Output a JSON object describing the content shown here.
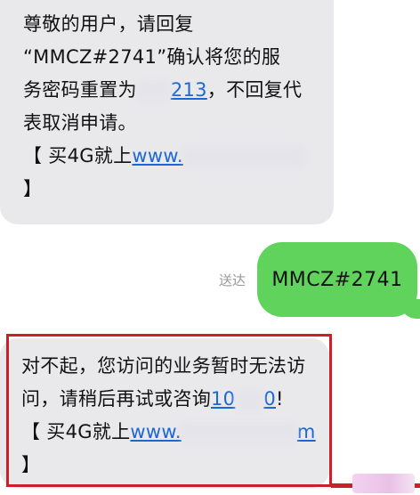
{
  "message1": {
    "line1": "尊敬的用户，请回复",
    "line2": "“MMCZ#2741”确认将您的服",
    "line3_prefix": "务密码重置为",
    "line3_link_visible": "213",
    "line3_suffix": "，不回复代",
    "line4": "表取消申请。",
    "line5_prefix": "【 买4G就上",
    "line5_link_visible": "www.",
    "line6": "】"
  },
  "sent": {
    "label": "送达",
    "text": "MMCZ#2741"
  },
  "message2": {
    "line1": "对不起，您访问的业务暂时无法访",
    "line2_prefix": "问，请稍后再试或咨询",
    "line2_link_visible": "10",
    "line2_link_end": "0",
    "line2_suffix": "!",
    "line3_prefix": "【 买4G就上",
    "line3_link_visible": "www.",
    "line3_link_end": "m",
    "line4": "】"
  },
  "colors": {
    "incoming_bubble": "#e9e9ec",
    "outgoing_bubble": "#5fd35b",
    "link": "#1c67d6",
    "highlight": "#c9202a"
  }
}
